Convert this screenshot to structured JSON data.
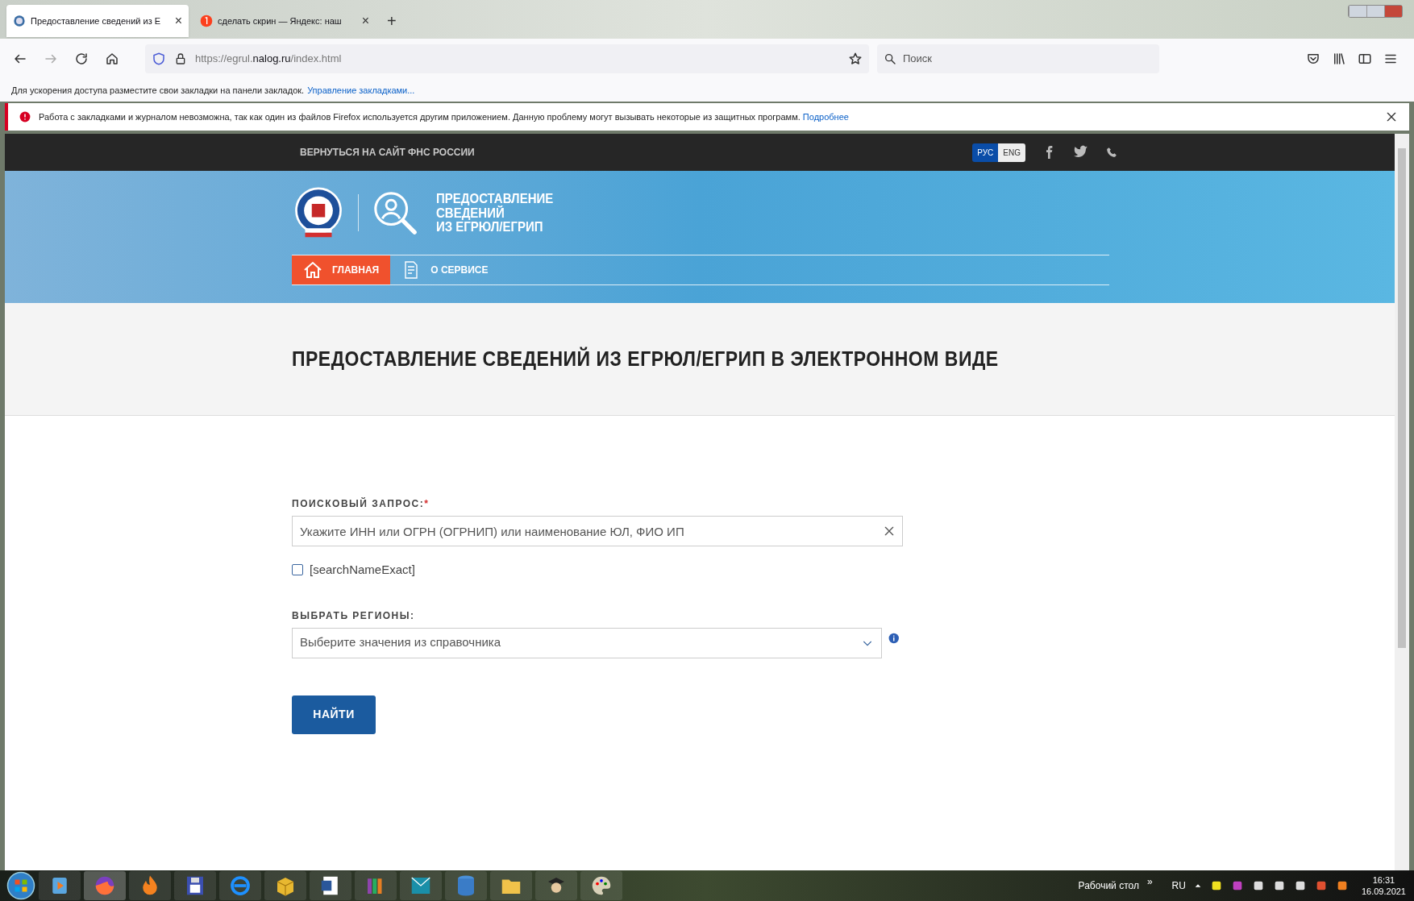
{
  "browser": {
    "tabs": [
      {
        "title": "Предоставление сведений из Е",
        "selected": true,
        "close": "×"
      },
      {
        "title": "сделать скрин — Яндекс: наш",
        "selected": false,
        "close": "×"
      }
    ],
    "new_tab": "+",
    "url": {
      "prefix": "https://egrul.",
      "domain": "nalog.ru",
      "path": "/index.html"
    },
    "search": {
      "placeholder": "Поиск"
    },
    "bookmarks_bar": {
      "text": "Для ускорения доступа разместите свои закладки на панели закладок.",
      "link": "Управление закладками..."
    },
    "notification": {
      "text": "Работа с закладками и журналом невозможна, так как один из файлов Firefox используется другим приложением. Данную проблему могут вызывать некоторые из защитных программ.",
      "link": "Подробнее"
    }
  },
  "site": {
    "back_link": "ВЕРНУТЬСЯ НА САЙТ ФНС РОССИИ",
    "languages": [
      {
        "label": "РУС",
        "selected": true
      },
      {
        "label": "ENG",
        "selected": false
      }
    ],
    "logo_text": [
      "ПРЕДОСТАВЛЕНИЕ",
      "СВЕДЕНИЙ",
      "ИЗ ЕГРЮЛ/ЕГРИП"
    ],
    "nav": [
      {
        "label": "ГЛАВНАЯ",
        "selected": true,
        "kind": "home"
      },
      {
        "label": "О СЕРВИСЕ",
        "selected": false,
        "kind": "document"
      }
    ],
    "heading": "ПРЕДОСТАВЛЕНИЕ СВЕДЕНИЙ ИЗ ЕГРЮЛ/ЕГРИП В ЭЛЕКТРОННОМ ВИДЕ",
    "form": {
      "query_label": "ПОИСКОВЫЙ ЗАПРОС:",
      "required_mark": "*",
      "query_placeholder": "Укажите ИНН или ОГРН (ОГРНИП) или наименование ЮЛ, ФИО ИП",
      "exact": {
        "label": "[searchNameExact]",
        "checked": false
      },
      "regions_label": "ВЫБРАТЬ РЕГИОНЫ:",
      "regions_placeholder": "Выберите значения из справочника",
      "submit": "НАЙТИ"
    }
  },
  "taskbar": {
    "desktop": "Рабочий стол",
    "more": "»",
    "language": "RU",
    "time": "16:31",
    "date": "16.09.2021"
  }
}
